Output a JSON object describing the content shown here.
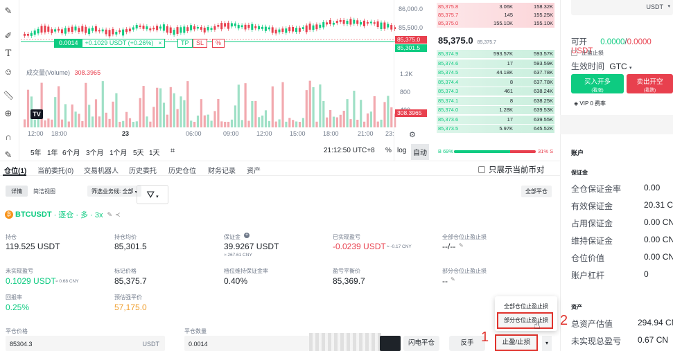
{
  "chart": {
    "volume_label": "成交量(Volume)",
    "volume_value": "308.3965",
    "position_line": {
      "qty": "0.0014",
      "pnl": "+0.1029 USDT (+0.26%)",
      "tp": "TP",
      "sl": "SL",
      "pct_icon": "%"
    },
    "price_ticks": [
      "86,000.0",
      "85,500.0",
      "1.2K",
      "800",
      "400"
    ],
    "last_price_tag": "85,375.0",
    "mark_price_tag": "85,301.5",
    "volume_tag": "308.3965",
    "time_ticks": [
      "12:00",
      "18:00",
      "23",
      "06:00",
      "09:00",
      "12:00",
      "15:00",
      "18:00",
      "21:00",
      "23:"
    ],
    "ranges": [
      "5年",
      "1年",
      "6个月",
      "3个月",
      "1个月",
      "5天",
      "1天"
    ],
    "clock": "21:12:50 UTC+8",
    "pct_label": "%",
    "log_label": "log",
    "auto_label": "自动"
  },
  "orderbook": {
    "asks": [
      {
        "price": "85,375.8",
        "amount": "3.06K",
        "total": "158.32K"
      },
      {
        "price": "85,375.7",
        "amount": "145",
        "total": "155.25K"
      },
      {
        "price": "85,375.0",
        "amount": "155.10K",
        "total": "155.10K"
      }
    ],
    "mid_price": "85,375.0",
    "mid_mark": "85,375.7",
    "bids": [
      {
        "price": "85,374.9",
        "amount": "593.57K",
        "total": "593.57K"
      },
      {
        "price": "85,374.6",
        "amount": "17",
        "total": "593.59K"
      },
      {
        "price": "85,374.5",
        "amount": "44.18K",
        "total": "637.78K"
      },
      {
        "price": "85,374.4",
        "amount": "8",
        "total": "637.78K"
      },
      {
        "price": "85,374.3",
        "amount": "461",
        "total": "638.24K"
      },
      {
        "price": "85,374.1",
        "amount": "8",
        "total": "638.25K"
      },
      {
        "price": "85,374.0",
        "amount": "1.28K",
        "total": "639.53K"
      },
      {
        "price": "85,373.6",
        "amount": "17",
        "total": "639.55K"
      },
      {
        "price": "85,373.5",
        "amount": "5.97K",
        "total": "645.52K"
      }
    ],
    "buy_pct": "B 69%",
    "sell_pct": "31% S",
    "buy_fraction": 0.69
  },
  "order_panel": {
    "currency": "USDT",
    "open_label": "可开",
    "open_buy": "0.0000",
    "open_sep": "/",
    "open_sell": "0.0000 USDT",
    "tpsl_checkbox": "止盈止损",
    "tif_label": "生效时间",
    "tif_value": "GTC",
    "buy_button": "买入开多",
    "buy_sub": "(看涨)",
    "sell_button": "卖出开空",
    "sell_sub": "(看跌)",
    "vip_label": "VIP 0 费率"
  },
  "account": {
    "title": "账户",
    "margin_title": "保证金",
    "rows": [
      {
        "label": "全仓保证金率",
        "value": "0.00"
      },
      {
        "label": "有效保证金",
        "value": "20.31 CN"
      },
      {
        "label": "占用保证金",
        "value": "0.00 CN"
      },
      {
        "label": "维持保证金",
        "value": "0.00 CN"
      },
      {
        "label": "仓位价值",
        "value": "0.00 CN"
      },
      {
        "label": "账户杠杆",
        "value": "0"
      }
    ],
    "assets_title": "资产",
    "asset_rows": [
      {
        "label": "总资产估值",
        "value": "294.94 CN"
      },
      {
        "label": "未实现总盈亏",
        "value": "0.67 CN"
      }
    ]
  },
  "positions": {
    "tabs": [
      "仓位(1)",
      "当前委托(0)",
      "交易机器人",
      "历史委托",
      "历史仓位",
      "财务记录",
      "资产"
    ],
    "only_current": "只展示当前币对",
    "view_detail": "详情",
    "view_compact": "简洁视图",
    "filter_line": "筛选业务线: 全部",
    "close_all": "全部平仓",
    "symbol": "BTCUSDT",
    "symbol_meta": "· 逐仓 · 多 · 3x",
    "fields": {
      "hold_label": "持仓",
      "hold_value": "119.525 USDT",
      "avg_label": "持仓均价",
      "avg_value": "85,301.5",
      "margin_label": "保证金",
      "margin_value": "39.9267 USDT",
      "margin_sub": "≈ 267.61 CNY",
      "realized_label": "已实现盈亏",
      "realized_value": "-0.0239 USDT",
      "realized_sub": "≈ -0.17 CNY",
      "all_tpsl_label": "全部仓位止盈止损",
      "all_tpsl_value": "--/--",
      "unreal_label": "未实现盈亏",
      "unreal_value": "0.1029 USDT",
      "unreal_sub": "≈ 0.68 CNY",
      "mark_label": "标记价格",
      "mark_value": "85,375.7",
      "mmr_label": "档位维持保证金率",
      "mmr_value": "0.40%",
      "breakeven_label": "盈亏平衡价",
      "breakeven_value": "85,369.7",
      "part_tpsl_label": "部分仓位止盈止损",
      "part_tpsl_value": "--",
      "roe_label": "回报率",
      "roe_value": "0.25%",
      "liq_label": "预估强平价",
      "liq_value": "57,175.0"
    },
    "close_price_label": "平仓价格",
    "close_price_value": "85304.3",
    "close_price_unit": "USDT",
    "close_qty_label": "平仓数量",
    "close_qty_value": "0.0014",
    "flash_close": "闪电平仓",
    "reverse": "反手",
    "tpsl_button": "止盈/止损",
    "menu_all": "全部仓位止盈止损",
    "menu_partial": "部分仓位止盈止损",
    "step1": "1",
    "step2": "2",
    "accent_green": "#0ecb81",
    "accent_red": "#e8404e",
    "annotation_red": "#e0322c"
  }
}
